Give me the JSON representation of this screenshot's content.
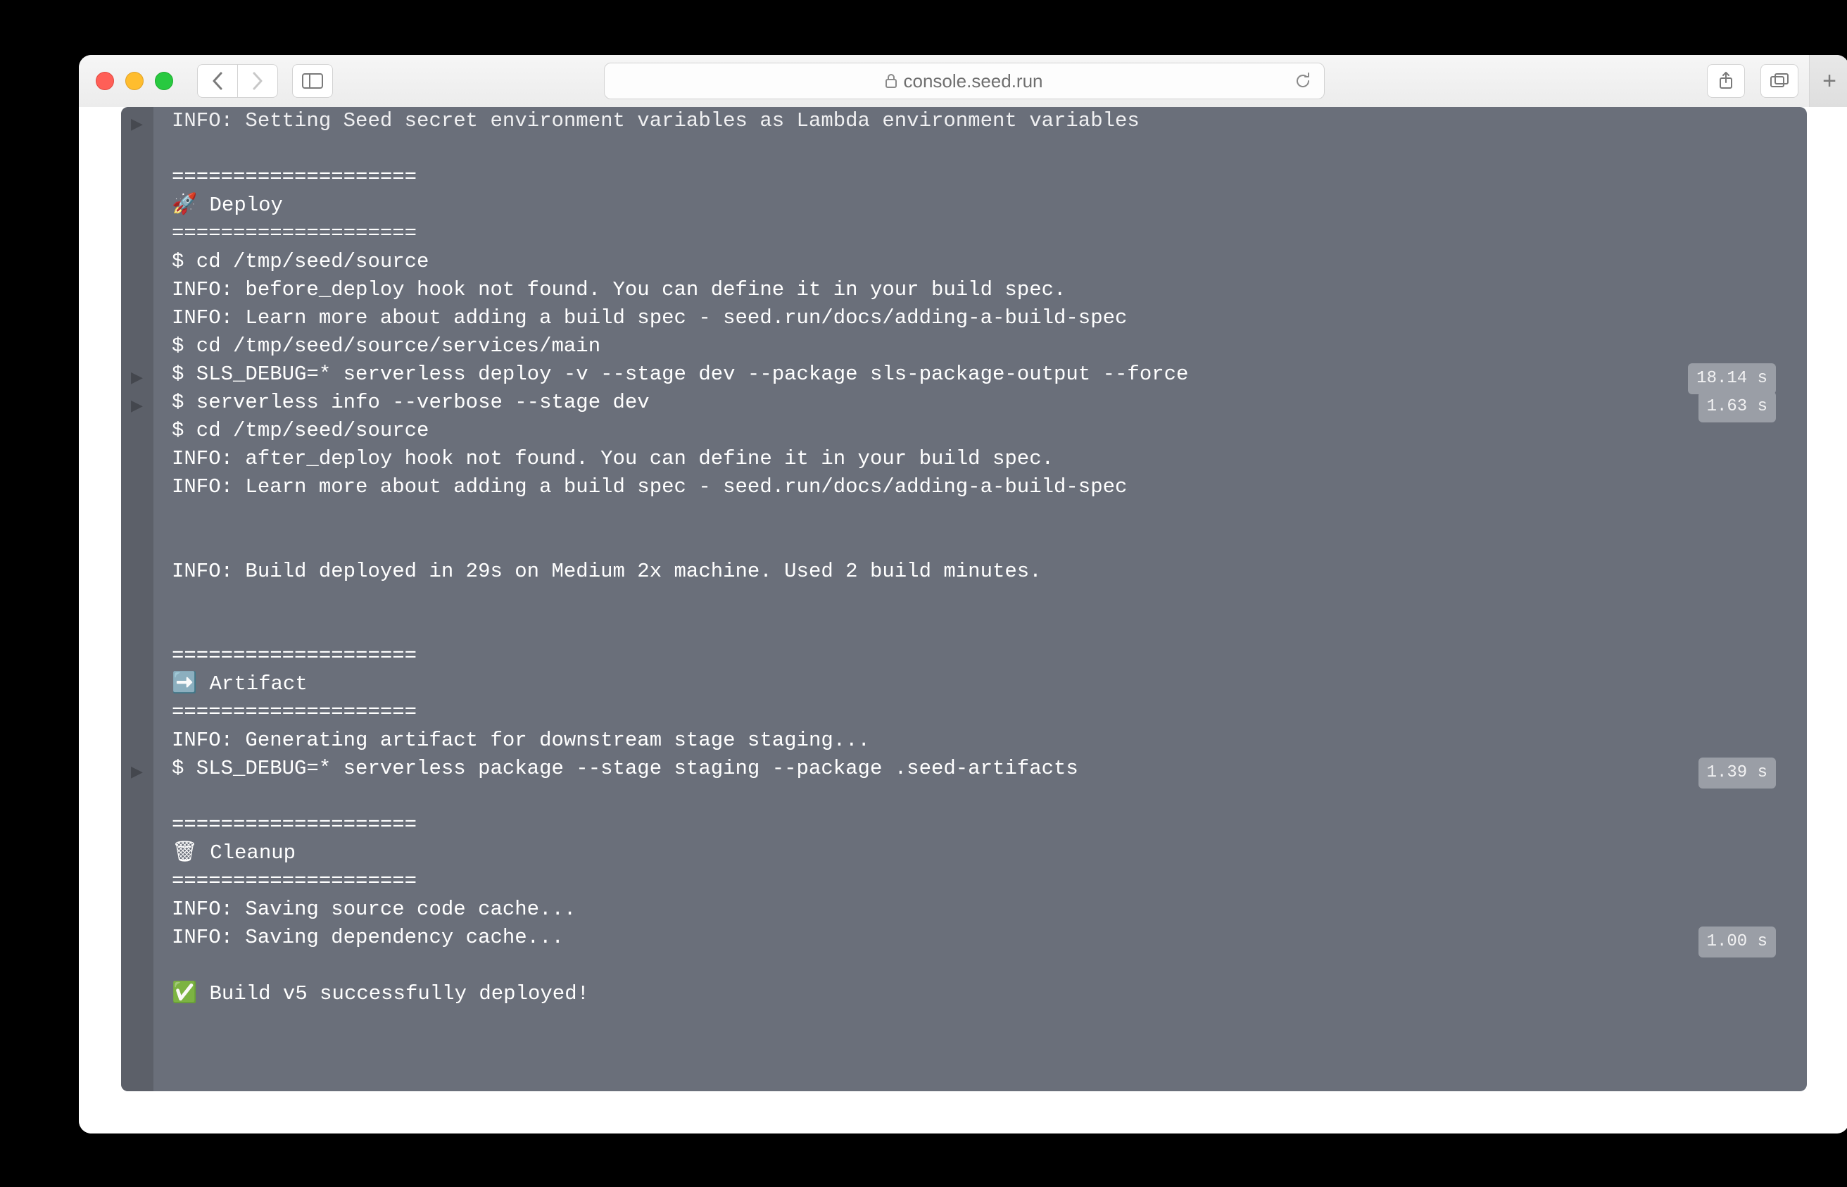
{
  "browser": {
    "url": "console.seed.run"
  },
  "terminal": {
    "lines": [
      {
        "text": "INFO: Setting Seed secret environment variables as Lambda environment variables",
        "caret": true,
        "dim": true
      },
      {
        "text": ""
      },
      {
        "text": "===================="
      },
      {
        "text": "🚀 Deploy"
      },
      {
        "text": "===================="
      },
      {
        "text": "$ cd /tmp/seed/source"
      },
      {
        "text": "INFO: before_deploy hook not found. You can define it in your build spec."
      },
      {
        "text": "INFO: Learn more about adding a build spec - seed.run/docs/adding-a-build-spec"
      },
      {
        "text": "$ cd /tmp/seed/source/services/main"
      },
      {
        "text": "$ SLS_DEBUG=* serverless deploy -v --stage dev --package sls-package-output --force",
        "caret": true,
        "time": "18.14 s"
      },
      {
        "text": "$ serverless info --verbose --stage dev",
        "caret": true,
        "time": "1.63 s"
      },
      {
        "text": "$ cd /tmp/seed/source"
      },
      {
        "text": "INFO: after_deploy hook not found. You can define it in your build spec."
      },
      {
        "text": "INFO: Learn more about adding a build spec - seed.run/docs/adding-a-build-spec"
      },
      {
        "text": ""
      },
      {
        "text": ""
      },
      {
        "text": "INFO: Build deployed in 29s on Medium 2x machine. Used 2 build minutes."
      },
      {
        "text": ""
      },
      {
        "text": ""
      },
      {
        "text": "===================="
      },
      {
        "text": "➡️ Artifact"
      },
      {
        "text": "===================="
      },
      {
        "text": "INFO: Generating artifact for downstream stage staging..."
      },
      {
        "text": "$ SLS_DEBUG=* serverless package --stage staging --package .seed-artifacts",
        "caret": true,
        "time": "1.39 s"
      },
      {
        "text": ""
      },
      {
        "text": "===================="
      },
      {
        "text": "🗑 Cleanup"
      },
      {
        "text": "===================="
      },
      {
        "text": "INFO: Saving source code cache..."
      },
      {
        "text": "INFO: Saving dependency cache...",
        "time": "1.00 s"
      },
      {
        "text": ""
      },
      {
        "text": "✅ Build v5 successfully deployed!"
      }
    ]
  }
}
